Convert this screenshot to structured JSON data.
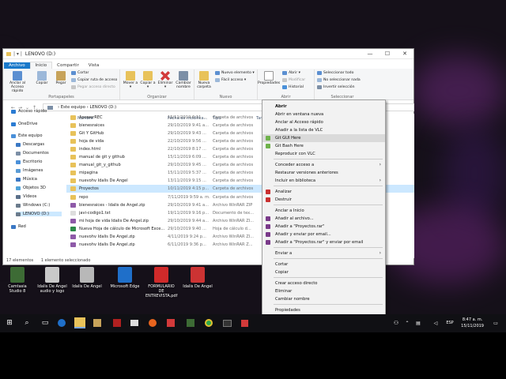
{
  "window": {
    "title": "LENOVO (D:)",
    "minimize": "—",
    "maximize": "☐",
    "close": "✕"
  },
  "tabs": [
    "Archivo",
    "Inicio",
    "Compartir",
    "Vista"
  ],
  "ribbon": {
    "portapapeles": {
      "anclar": "Anclar al Acceso rápido",
      "copiar": "Copiar",
      "pegar": "Pegar",
      "cortar": "Cortar",
      "copiar_ruta": "Copiar ruta de acceso",
      "pegar_acceso": "Pegar acceso directo",
      "group": "Portapapeles"
    },
    "organizar": {
      "mover": "Mover a ▾",
      "copiar": "Copiar a ▾",
      "eliminar": "Eliminar ▾",
      "cambiar": "Cambiar nombre",
      "group": "Organizar"
    },
    "nuevo": {
      "carpeta": "Nueva carpeta",
      "nuevo_elemento": "Nuevo elemento ▾",
      "facil_acceso": "Fácil acceso ▾",
      "group": "Nuevo"
    },
    "abrir": {
      "propiedades": "Propiedades",
      "abrir": "Abrir ▾",
      "modificar": "Modificar",
      "historial": "Historial",
      "group": "Abrir"
    },
    "seleccionar": {
      "todo": "Seleccionar todo",
      "nada": "No seleccionar nada",
      "invertir": "Invertir selección",
      "group": "Seleccionar"
    }
  },
  "address": {
    "path": "›  Este equipo  ›  LENOVO (D:)",
    "back": "←",
    "forward": "→",
    "recent": "⌄",
    "up": "↑"
  },
  "nav": [
    {
      "label": "Acceso rápido",
      "color": "#2b7cd3"
    },
    {
      "label": "OneDrive",
      "color": "#2b7cd3"
    },
    {
      "label": "Este equipo",
      "color": "#4a90d9"
    },
    {
      "label": "Descargas",
      "color": "#3b78c4"
    },
    {
      "label": "Documentos",
      "color": "#7c8fa6"
    },
    {
      "label": "Escritorio",
      "color": "#4a90d9"
    },
    {
      "label": "Imágenes",
      "color": "#5a9bd5"
    },
    {
      "label": "Música",
      "color": "#3b78c4"
    },
    {
      "label": "Objetos 3D",
      "color": "#4fa3d9"
    },
    {
      "label": "Vídeos",
      "color": "#5a6f8a"
    },
    {
      "label": "Windows (C:)",
      "color": "#6b7b8c"
    },
    {
      "label": "LENOVO (D:)",
      "color": "#6b7b8c"
    },
    {
      "label": "Red",
      "color": "#3b78c4"
    }
  ],
  "columns": {
    "name": "Nombre",
    "date": "Fecha de modifica...",
    "type": "Tipo",
    "size": "Tam"
  },
  "files": [
    {
      "name": "ApowerREC",
      "date": "15/11/2019 6:11 ...",
      "type": "Carpeta de archivos",
      "icon": "folder"
    },
    {
      "name": "bienesraices",
      "date": "29/10/2019 9:41 a...",
      "type": "Carpeta de archivos",
      "icon": "folder"
    },
    {
      "name": "Git Y GitHub",
      "date": "29/10/2019 9:43 ...",
      "type": "Carpeta de archivos",
      "icon": "folder"
    },
    {
      "name": "hoja de vida",
      "date": "22/10/2019 9:56 ...",
      "type": "Carpeta de archivos",
      "icon": "folder"
    },
    {
      "name": "index.html",
      "date": "22/10/2019 8:17 ...",
      "type": "Carpeta de archivos",
      "icon": "folder"
    },
    {
      "name": "manual de git y github",
      "date": "15/11/2019 6:09 ...",
      "type": "Carpeta de archivos",
      "icon": "folder"
    },
    {
      "name": "manual_git_y_github",
      "date": "29/10/2019 9:45 ...",
      "type": "Carpeta de archivos",
      "icon": "folder"
    },
    {
      "name": "mipagina",
      "date": "15/11/2019 5:37 ...",
      "type": "Carpeta de archivos",
      "icon": "folder"
    },
    {
      "name": "nuevohv  Idalis De Angel",
      "date": "13/11/2019 9:15 ...",
      "type": "Carpeta de archivos",
      "icon": "folder"
    },
    {
      "name": "Proyectos",
      "date": "10/11/2019 4:15 p...",
      "type": "Carpeta de archivos",
      "icon": "folder",
      "selected": true
    },
    {
      "name": "repo",
      "date": "7/11/2019 9:59 a. m.",
      "type": "Carpeta de archivos",
      "icon": "folder"
    },
    {
      "name": "bienesraices - Idalis de Angel.zip",
      "date": "29/10/2019 9:41 a...",
      "type": "Archivo WinRAR ZIP",
      "icon": "zip"
    },
    {
      "name": "javi-codigo1.txt",
      "date": "19/11/2019 9:16 p...",
      "type": "Documento de tex...",
      "icon": "txt"
    },
    {
      "name": "mi hoja de vida Idalis De Angel.zip",
      "date": "29/10/2019 9:44 a...",
      "type": "Archivo WinRAR ZI...",
      "icon": "zip"
    },
    {
      "name": "Nueva Hoja de cálculo de Microsoft Exce...",
      "date": "29/10/2019 9:40 ...",
      "type": "Hoja de cálculo d...",
      "icon": "xls"
    },
    {
      "name": "nuevohv  Idalis De Angel.zip",
      "date": "4/11/2019 9:24 p...",
      "type": "Archivo WinRAR ZI...",
      "icon": "zip"
    },
    {
      "name": "nuevohv  Idalis De Angel.zip",
      "date": "6/11/2019 9:36 p...",
      "type": "Archivo WinRAR Z...",
      "icon": "zip"
    }
  ],
  "status": {
    "count": "17 elementos",
    "selected": "1 elemento seleccionado"
  },
  "context_menu": [
    {
      "label": "Abrir",
      "bold": true
    },
    {
      "label": "Abrir en ventana nueva"
    },
    {
      "label": "Anclar al Acceso rápido"
    },
    {
      "label": "Añadir a la lista de VLC"
    },
    {
      "label": "Git GUI Here",
      "icon": "git",
      "highlight": true
    },
    {
      "label": "Git Bash Here",
      "icon": "git"
    },
    {
      "label": "Reproducir con VLC"
    },
    {
      "sep": true
    },
    {
      "label": "Conceder acceso a",
      "arrow": true
    },
    {
      "label": "Restaurar versiones anteriores"
    },
    {
      "label": "Incluir en biblioteca",
      "arrow": true
    },
    {
      "sep": true
    },
    {
      "label": "Analizar",
      "icon": "shield"
    },
    {
      "label": "Destruir",
      "icon": "shield"
    },
    {
      "sep": true
    },
    {
      "label": "Anclar a Inicio"
    },
    {
      "label": "Añadir al archivo...",
      "icon": "rar"
    },
    {
      "label": "Añadir a \"Proyectos.rar\"",
      "icon": "rar"
    },
    {
      "label": "Añadir y enviar por email...",
      "icon": "rar"
    },
    {
      "label": "Añadir a \"Proyectos.rar\" y enviar por email",
      "icon": "rar"
    },
    {
      "sep": true
    },
    {
      "label": "Enviar a",
      "arrow": true
    },
    {
      "sep": true
    },
    {
      "label": "Cortar"
    },
    {
      "label": "Copiar"
    },
    {
      "sep": true
    },
    {
      "label": "Crear acceso directo"
    },
    {
      "label": "Eliminar"
    },
    {
      "label": "Cambiar nombre"
    },
    {
      "sep": true
    },
    {
      "label": "Propiedades"
    }
  ],
  "desktop_icons": [
    {
      "label": "Camtasia Studio 8",
      "color": "#3d6b35"
    },
    {
      "label": "Idalis De Angel audio y logo",
      "color": "#c9c9c9"
    },
    {
      "label": "Idalis De Angel",
      "color": "#b8b8b8"
    },
    {
      "label": "Microsoft Edge",
      "color": "#1f6fc9"
    },
    {
      "label": "FORMULARIO DE ENTREVISTA.pdf",
      "color": "#d02a2a"
    },
    {
      "label": "Idalis De Angel",
      "color": "#cc3333"
    }
  ],
  "taskbar": {
    "time": "8:47 a. m.",
    "date": "15/11/2019",
    "lang": "ESP",
    "start": "⊞",
    "search": "⌕",
    "taskview": "▭"
  },
  "colors": {
    "accent": "#1979ca",
    "selected_row": "#cce8ff",
    "folder": "#e8c25a"
  }
}
